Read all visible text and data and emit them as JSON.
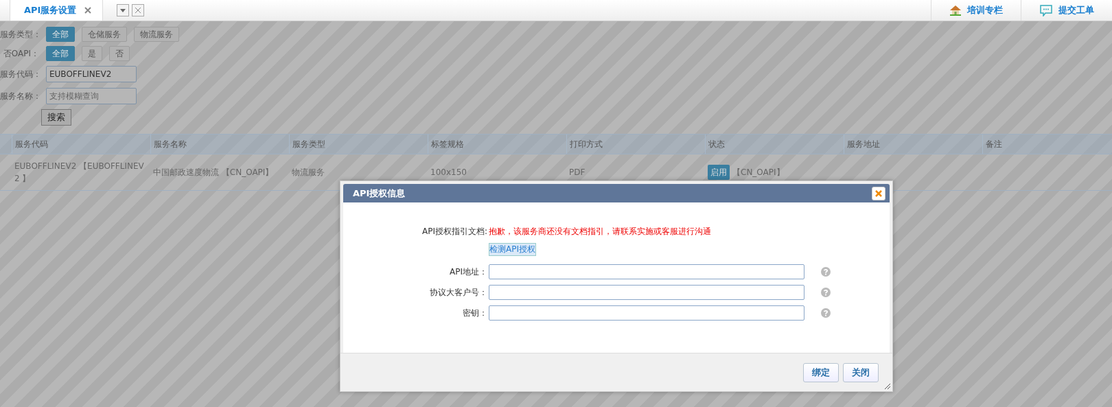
{
  "tabs": [
    {
      "label": "API服务设置",
      "selected": true
    }
  ],
  "top_links": [
    {
      "kind": "house",
      "label": "培训专栏"
    },
    {
      "kind": "chat",
      "label": "提交工单"
    }
  ],
  "filters": [
    {
      "kind": "options",
      "label": "服务类型：",
      "options": [
        {
          "label": "全部",
          "selected": true
        },
        {
          "label": "仓储服务",
          "selected": false
        },
        {
          "label": "物流服务",
          "selected": false
        }
      ]
    },
    {
      "kind": "options",
      "label": "否OAPI：",
      "options": [
        {
          "label": "全部",
          "selected": true
        },
        {
          "label": "是",
          "selected": false
        },
        {
          "label": "否",
          "selected": false
        }
      ]
    },
    {
      "kind": "input",
      "label": "服务代码：",
      "value": "EUBOFFLINEV2"
    },
    {
      "kind": "input",
      "label": "服务名称：",
      "placeholder": "支持模糊查询"
    }
  ],
  "search_button": "搜索",
  "table": {
    "columns": [
      "服务代码",
      "服务名称",
      "服务类型",
      "标签规格",
      "打印方式",
      "状态",
      "服务地址",
      "备注"
    ],
    "rows": [
      {
        "cells": [
          {
            "kind": "text",
            "text": "EUBOFFLINEV2 【EUBOFFLINEV2 】"
          },
          {
            "kind": "text",
            "text": "中国邮政速度物流 【CN_OAPI】"
          },
          {
            "kind": "text",
            "text": "物流服务"
          },
          {
            "kind": "text",
            "text": "100x150"
          },
          {
            "kind": "text",
            "text": "PDF"
          },
          {
            "kind": "status",
            "badge": "启用",
            "text": "【CN_OAPI】"
          },
          {
            "kind": "text",
            "text": ""
          },
          {
            "kind": "text",
            "text": ""
          }
        ]
      }
    ]
  },
  "dialog": {
    "title": "API授权信息",
    "doc_label": "API授权指引文档:",
    "doc_message": "抱歉，该服务商还没有文档指引，请联系实施或客服进行沟通",
    "check_link": "检测API授权",
    "fields": [
      {
        "label": "API地址："
      },
      {
        "label": "协议大客户号："
      },
      {
        "label": "密钥："
      }
    ],
    "buttons": [
      "绑定",
      "关闭"
    ]
  }
}
